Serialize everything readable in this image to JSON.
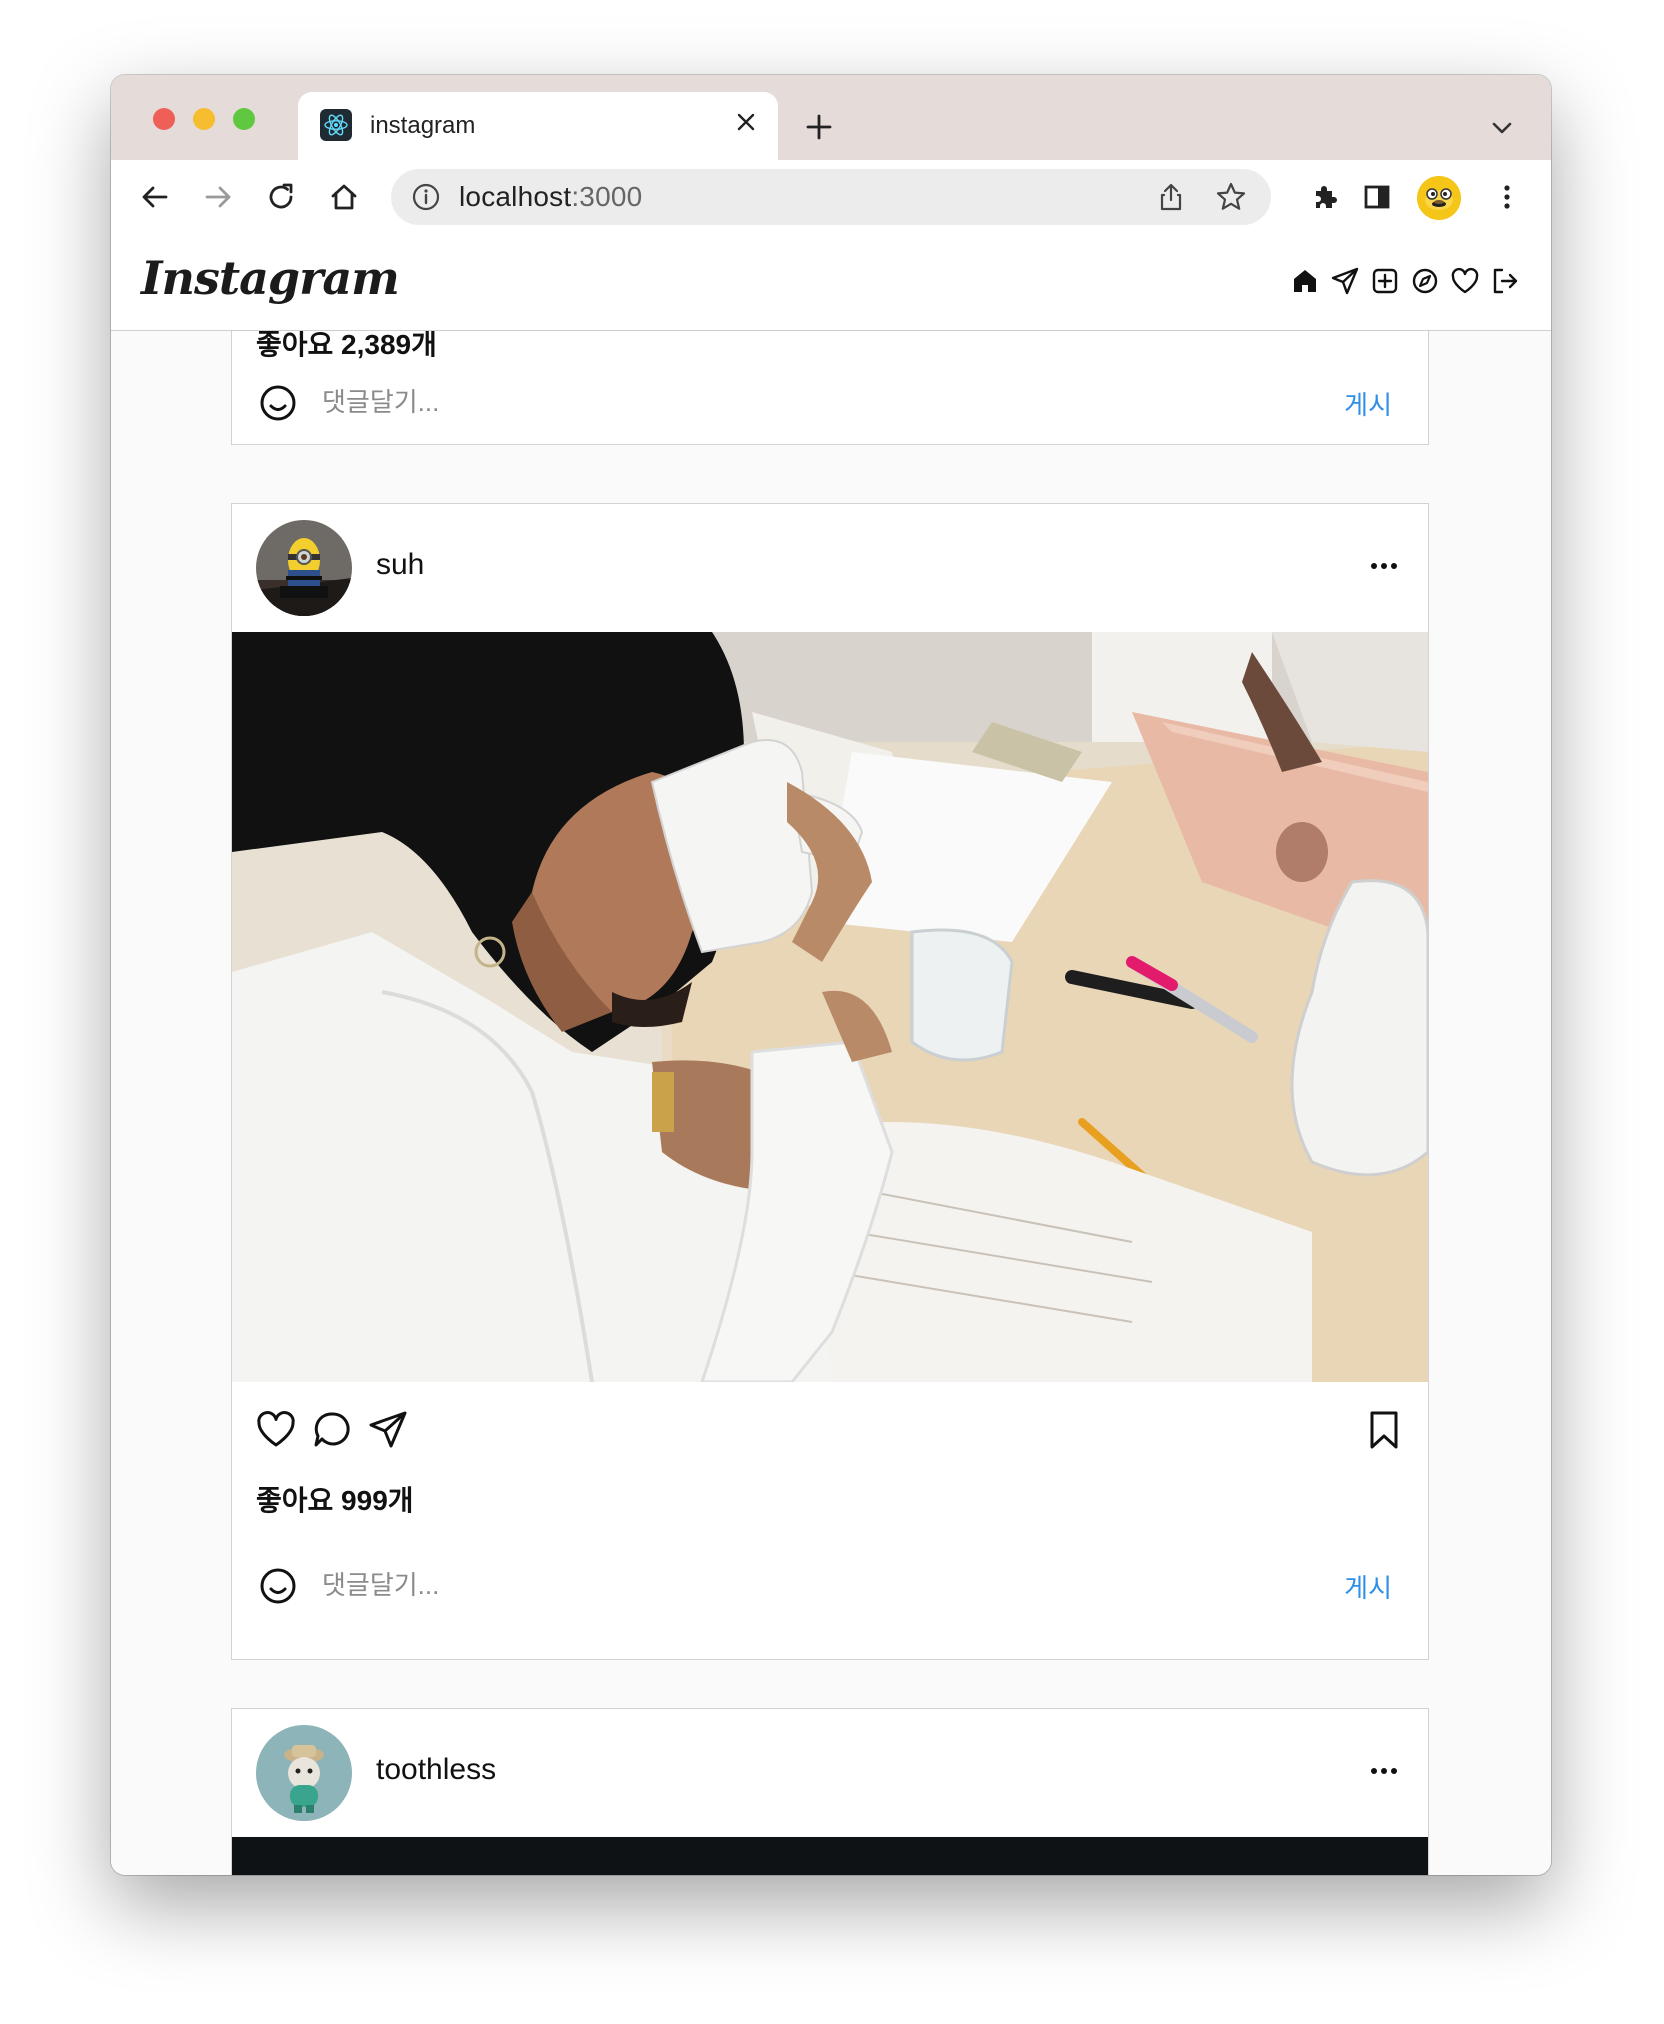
{
  "browser": {
    "tab": {
      "title": "instagram"
    },
    "url": {
      "host": "localhost",
      "port": ":3000"
    }
  },
  "app": {
    "logo": "Instagram",
    "nav": [
      "home-icon",
      "direct-icon",
      "new-post-icon",
      "explore-icon",
      "activity-icon",
      "logout-icon"
    ]
  },
  "feed": {
    "post0": {
      "likes": "좋아요 2,389개",
      "comment_placeholder": "댓글달기...",
      "post_label": "게시"
    },
    "post1": {
      "username": "suh",
      "likes": "좋아요 999개",
      "comment_placeholder": "댓글달기...",
      "post_label": "게시"
    },
    "post2": {
      "username": "toothless"
    }
  },
  "colors": {
    "link": "#2f8fe8",
    "tabstrip": "#e5dcd9"
  }
}
